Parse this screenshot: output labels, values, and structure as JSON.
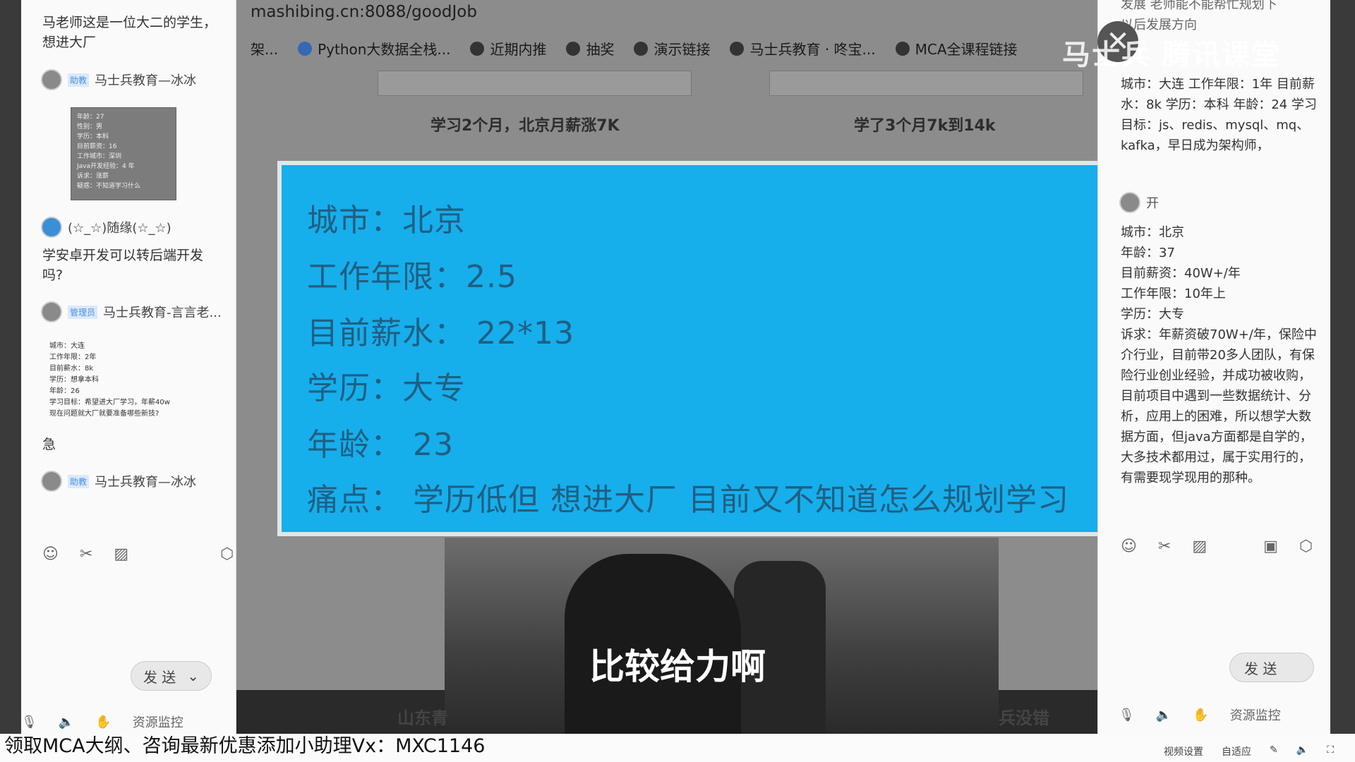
{
  "left_chat": {
    "msg1": "马老师这是一位大二的学生，",
    "msg1b": "想进大厂",
    "user1_badge": "助教",
    "user1_name": "马士兵教育—冰冰",
    "card_lines": [
      "年龄：27",
      "性别：男",
      "学历：本科",
      "目前薪资：16",
      "工作城市：深圳",
      "Java开发经验：4 年",
      "诉求：涨薪",
      "疑惑：不知道学习什么"
    ],
    "user2_name": "(☆_☆)随缘(☆_☆)",
    "msg2": "学安卓开发可以转后端开发",
    "msg2b": "吗?",
    "user3_badge": "管理员",
    "user3_name": "马士兵教育-言言老...",
    "small_info": [
      "城市：大连",
      "工作年限：2年",
      "目前薪水：8k",
      "学历：想拿本科",
      "年龄：26",
      "学习目标：希望进大厂学习，年薪40w",
      "现在问题就大厂就要准备哪些新技?"
    ],
    "msg3": "急",
    "user4_badge": "助教",
    "user4_name": "马士兵教育—冰冰",
    "send_label": "发 送",
    "resource_monitor": "资源监控"
  },
  "browser": {
    "address": "mashibing.cn:8088/goodJob",
    "bookmarks": [
      "架...",
      "Python大数据全栈...",
      "近期内推",
      "抽奖",
      "演示链接",
      "马士兵教育 · 咚宝...",
      "MCA全课程链接"
    ],
    "caption_left": "学习2个月，北京月薪涨7K",
    "caption_right": "学了3个月7k到14k",
    "bottom_left": "山东青",
    "bottom_right": "兵没错"
  },
  "info_card": {
    "city": "城市：北京",
    "years": "工作年限：2.5",
    "salary": "目前薪水：  22*13",
    "education": "学历：大专",
    "age": "年龄：  23",
    "pain": "痛点：  学历低但 想进大厂  目前又不知道怎么规划学习"
  },
  "subtitle": "比较给力啊",
  "watermark": "马士兵  腾讯课堂",
  "right_chat": {
    "top_lines": "发展 老师能不能帮忙规划下\n以后发展方向",
    "para1": "城市：大连 工作年限：1年 目前薪水：8k 学历：本科 年龄：24 学习目标：js、redis、mysql、mq、kafka，早日成为架构师，",
    "user_name": "开",
    "para2": "城市：北京\n年龄：37\n目前薪资：40W+/年\n工作年限：10年上\n学历：大专\n诉求：年薪资破70W+/年，保险中介行业，目前带20多人团队，有保险行业创业经验，并成功被收购，目前项目中遇到一些数据统计、分析，应用上的困难，所以想学大数据方面，但java方面都是自学的，大多技术都用过，属于实用行的，有需要现学现用的那种。",
    "send_label": "发 送",
    "resource_monitor": "资源监控"
  },
  "ad_text": "领取MCA大纲、咨询最新优惠添加小助理Vx：MXC1146",
  "status_bar": [
    "视频设置",
    "自适应"
  ]
}
